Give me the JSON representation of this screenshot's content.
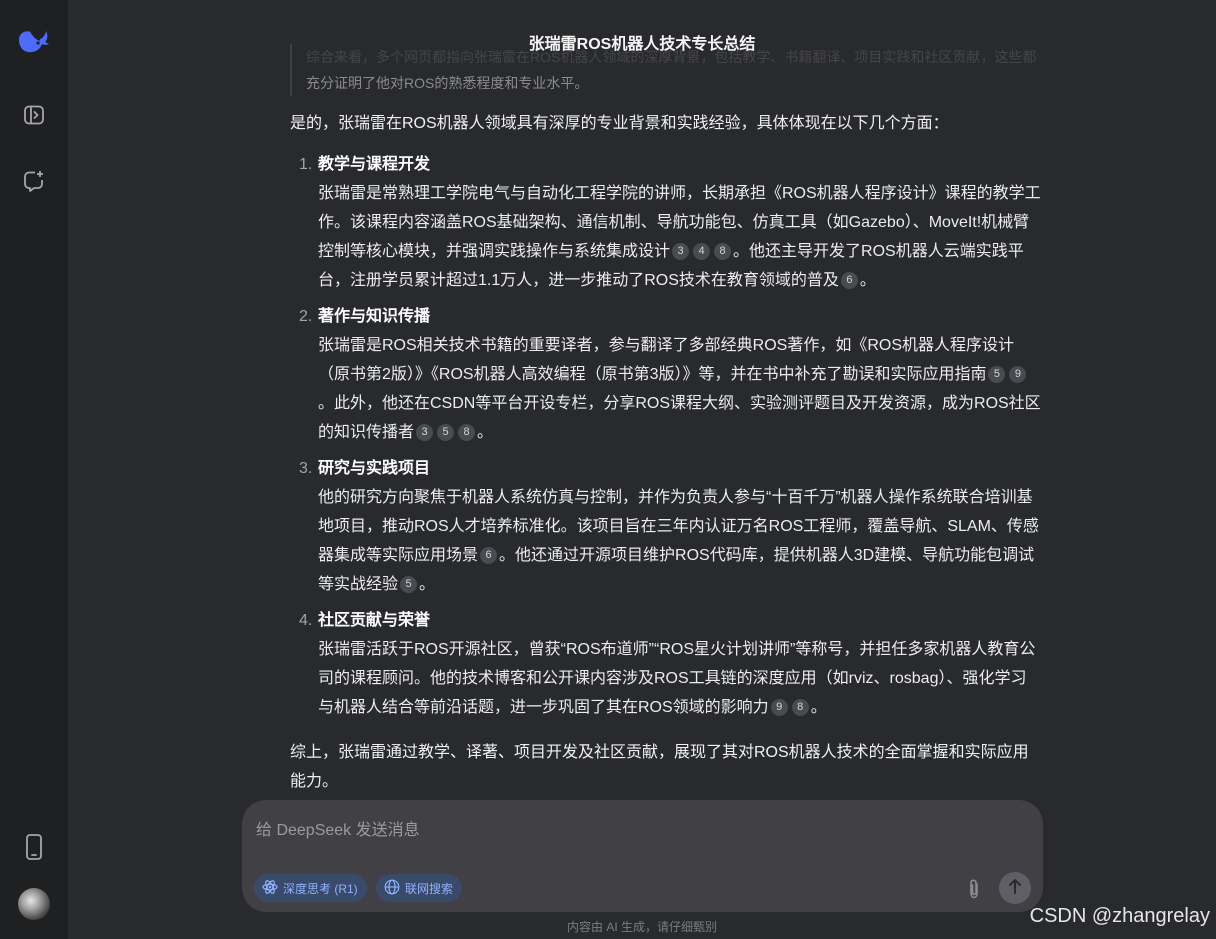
{
  "header": {
    "title": "张瑞雷ROS机器人技术专长总结"
  },
  "quote": {
    "line1": "综合来看，多个网页都指向张瑞雷在ROS机器人领域的深厚背景，包括教学、书籍翻译、项目实践和社区贡献，这些都",
    "line2": "充分证明了他对ROS的熟悉程度和专业水平。"
  },
  "answer": {
    "intro": "是的，张瑞雷在ROS机器人领域具有深厚的专业背景和实践经验，具体体现在以下几个方面：",
    "items": [
      {
        "num": "1.",
        "heading": "教学与课程开发",
        "t1": "张瑞雷是常熟理工学院电气与自动化工程学院的讲师，长期承担《ROS机器人程序设计》课程的教学工作。该课程内容涵盖ROS基础架构、通信机制、导航功能包、仿真工具（如Gazebo）、MoveIt!机械臂控制等核心模块，并强调实践操作与系统集成设计",
        "c1": [
          "3",
          "4",
          "8"
        ],
        "t2": "。他还主导开发了ROS机器人云端实践平台，注册学员累计超过1.1万人，进一步推动了ROS技术在教育领域的普及",
        "c2": [
          "6"
        ],
        "t3": "。"
      },
      {
        "num": "2.",
        "heading": "著作与知识传播",
        "t1": "张瑞雷是ROS相关技术书籍的重要译者，参与翻译了多部经典ROS著作，如《ROS机器人程序设计（原书第2版）》《ROS机器人高效编程（原书第3版）》等，并在书中补充了勘误和实际应用指南",
        "c1": [
          "5",
          "9"
        ],
        "t2": "。此外，他还在CSDN等平台开设专栏，分享ROS课程大纲、实验测评题目及开发资源，成为ROS社区的知识传播者",
        "c2": [
          "3",
          "5",
          "8"
        ],
        "t3": "。"
      },
      {
        "num": "3.",
        "heading": "研究与实践项目",
        "t1": "他的研究方向聚焦于机器人系统仿真与控制，并作为负责人参与“十百千万”机器人操作系统联合培训基地项目，推动ROS人才培养标准化。该项目旨在三年内认证万名ROS工程师，覆盖导航、SLAM、传感器集成等实际应用场景",
        "c1": [
          "6"
        ],
        "t2": "。他还通过开源项目维护ROS代码库，提供机器人3D建模、导航功能包调试等实战经验",
        "c2": [
          "5"
        ],
        "t3": "。"
      },
      {
        "num": "4.",
        "heading": "社区贡献与荣誉",
        "t1": "张瑞雷活跃于ROS开源社区，曾获“ROS布道师”“ROS星火计划讲师”等称号，并担任多家机器人教育公司的课程顾问。他的技术博客和公开课内容涉及ROS工具链的深度应用（如rviz、rosbag）、强化学习与机器人结合等前沿话题，进一步巩固了其在ROS领域的影响力",
        "c1": [
          "9",
          "8"
        ],
        "t2": "。",
        "c2": [],
        "t3": ""
      }
    ],
    "summary": "综上，张瑞雷通过教学、译著、项目开发及社区贡献，展现了其对ROS机器人技术的全面掌握和实际应用能力。"
  },
  "composer": {
    "placeholder": "给 DeepSeek 发送消息",
    "deep_think_label": "深度思考 (R1)",
    "web_search_label": "联网搜索"
  },
  "footer": {
    "disclaimer": "内容由 AI 生成，请仔细甄别",
    "watermark": "CSDN @zhangrelay"
  },
  "colors": {
    "sidebar_bg": "#1f2022",
    "main_bg": "#292a2d",
    "composer_bg": "#404045",
    "accent": "#4d6bfe",
    "chip_text": "#8fb2ff"
  },
  "icons": {
    "sidebar": [
      "deepseek-whale-logo-icon",
      "sidebar-toggle-icon",
      "new-chat-icon",
      "mobile-app-icon"
    ],
    "actions": [
      "copy-icon",
      "regenerate-icon",
      "thumbs-up-icon",
      "thumbs-down-icon"
    ],
    "composer": [
      "atom-icon",
      "globe-icon",
      "paperclip-icon",
      "arrow-up-icon"
    ]
  }
}
